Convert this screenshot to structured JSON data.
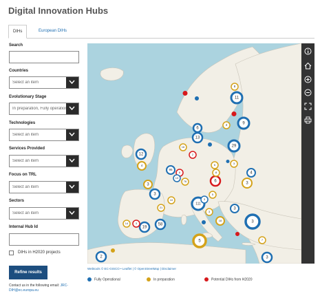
{
  "title": "Digital Innovation Hubs",
  "tabs": [
    {
      "label": "DIHs",
      "active": true
    },
    {
      "label": "European DIHs",
      "active": false
    }
  ],
  "filters": {
    "search_label": "Search",
    "search_value": "",
    "countries_label": "Countries",
    "countries_value": "Select an item",
    "evolutionary_label": "Evolutionary Stage",
    "evolutionary_value": "In preparation, Fully operational",
    "technologies_label": "Technologies",
    "technologies_value": "Select an item",
    "services_label": "Services Provided",
    "services_value": "Select an item",
    "trl_label": "Focus on TRL",
    "trl_value": "Select an item",
    "sectors_label": "Sectors",
    "sectors_value": "Select an item",
    "hub_id_label": "Internal Hub Id",
    "hub_id_value": "",
    "h2020_label": "DIHs in H2020 projects",
    "h2020_checked": false
  },
  "refine_button": "Refine results",
  "contact": {
    "text": "Contact us in the following email:",
    "email": "JRC-DIH@ec.europa.eu"
  },
  "attribution": {
    "leaflet_text": "Webtools",
    "rest": "© EC-GISCO • Leaflet | © OpenStreetMap | Disclaimer"
  },
  "legend": [
    {
      "label": "Fully Operational",
      "color": "#1f6fb2"
    },
    {
      "label": "In preparation",
      "color": "#d4a21a"
    },
    {
      "label": "Potential DIHs from H2020",
      "color": "#d7191c"
    }
  ],
  "colors": {
    "operational": "#1f6fb2",
    "preparation": "#d4a21a",
    "potential": "#d7191c"
  },
  "map_clusters": [
    {
      "count": "11",
      "kind": "op"
    },
    {
      "count": "8",
      "kind": "prep"
    },
    {
      "count": "9",
      "kind": "op"
    },
    {
      "count": "6",
      "kind": "op"
    },
    {
      "count": "13",
      "kind": "op"
    },
    {
      "count": "4",
      "kind": "prep"
    },
    {
      "count": "29",
      "kind": "op"
    },
    {
      "count": "12",
      "kind": "op"
    },
    {
      "count": "3",
      "kind": "op"
    },
    {
      "count": "111",
      "kind": "op"
    },
    {
      "count": "6",
      "kind": "potential"
    },
    {
      "count": "3",
      "kind": "op"
    },
    {
      "count": "19",
      "kind": "op"
    },
    {
      "count": "58",
      "kind": "op"
    },
    {
      "count": "3",
      "kind": "op"
    },
    {
      "count": "5",
      "kind": "prep"
    },
    {
      "count": "3",
      "kind": "op"
    },
    {
      "count": "3",
      "kind": "op"
    },
    {
      "count": "2",
      "kind": "op"
    },
    {
      "count": "14",
      "kind": "prep"
    },
    {
      "count": "76",
      "kind": "prep"
    },
    {
      "count": "95",
      "kind": "op"
    },
    {
      "count": "3",
      "kind": "prep"
    },
    {
      "count": "21",
      "kind": "prep"
    },
    {
      "count": "18",
      "kind": "prep"
    },
    {
      "count": "4",
      "kind": "op"
    },
    {
      "count": "10",
      "kind": "prep"
    },
    {
      "count": "6",
      "kind": "potential"
    },
    {
      "count": "4",
      "kind": "prep"
    },
    {
      "count": "3",
      "kind": "op"
    },
    {
      "count": "2",
      "kind": "potential"
    },
    {
      "count": "6",
      "kind": "prep"
    },
    {
      "count": "3",
      "kind": "prep"
    },
    {
      "count": "8",
      "kind": "prep"
    },
    {
      "count": "5",
      "kind": "prep"
    },
    {
      "count": "3",
      "kind": "prep"
    },
    {
      "count": "16",
      "kind": "prep"
    },
    {
      "count": "13",
      "kind": "op"
    },
    {
      "count": "3",
      "kind": "potential"
    },
    {
      "count": "7",
      "kind": "prep"
    }
  ],
  "toolbar": [
    "info-icon",
    "home-icon",
    "zoom-in-icon",
    "zoom-out-icon",
    "fullscreen-icon",
    "print-icon"
  ]
}
